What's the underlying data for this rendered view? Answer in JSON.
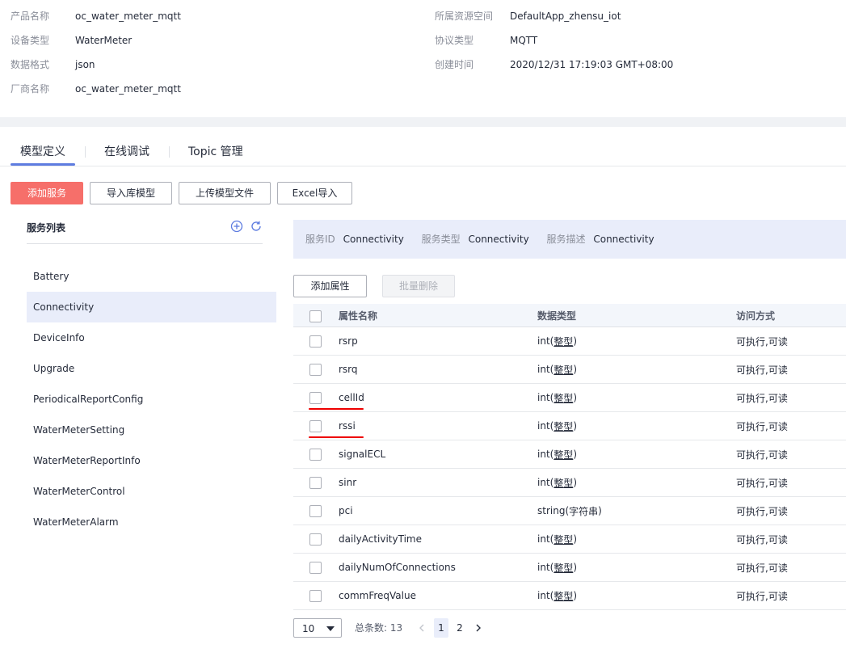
{
  "product_info": {
    "left": [
      {
        "label": "产品名称",
        "value": "oc_water_meter_mqtt"
      },
      {
        "label": "设备类型",
        "value": "WaterMeter"
      },
      {
        "label": "数据格式",
        "value": "json"
      },
      {
        "label": "厂商名称",
        "value": "oc_water_meter_mqtt"
      }
    ],
    "right": [
      {
        "label": "所属资源空间",
        "value": "DefaultApp_zhensu_iot"
      },
      {
        "label": "协议类型",
        "value": "MQTT"
      },
      {
        "label": "创建时间",
        "value": "2020/12/31 17:19:03 GMT+08:00"
      }
    ]
  },
  "tabs": [
    {
      "label": "模型定义",
      "active": true
    },
    {
      "label": "在线调试",
      "active": false
    },
    {
      "label": "Topic 管理",
      "active": false
    }
  ],
  "toolbar": {
    "add_service": "添加服务",
    "import_library_model": "导入库模型",
    "upload_model_file": "上传模型文件",
    "excel_import": "Excel导入"
  },
  "service_list": {
    "title": "服务列表",
    "selected": "Connectivity",
    "items": [
      "Battery",
      "Connectivity",
      "DeviceInfo",
      "Upgrade",
      "PeriodicalReportConfig",
      "WaterMeterSetting",
      "WaterMeterReportInfo",
      "WaterMeterControl",
      "WaterMeterAlarm"
    ]
  },
  "service_summary": {
    "id_label": "服务ID",
    "id_value": "Connectivity",
    "type_label": "服务类型",
    "type_value": "Connectivity",
    "desc_label": "服务描述",
    "desc_value": "Connectivity"
  },
  "property_actions": {
    "add_property": "添加属性",
    "batch_delete": "批量删除"
  },
  "property_table": {
    "columns": [
      "属性名称",
      "数据类型",
      "访问方式"
    ],
    "rows": [
      {
        "name": "rsrp",
        "type_prefix": "int(",
        "type_word": "整型",
        "type_suffix": ")",
        "access": "可执行,可读",
        "marked": false
      },
      {
        "name": "rsrq",
        "type_prefix": "int(",
        "type_word": "整型",
        "type_suffix": ")",
        "access": "可执行,可读",
        "marked": false
      },
      {
        "name": "cellId",
        "type_prefix": "int(",
        "type_word": "整型",
        "type_suffix": ")",
        "access": "可执行,可读",
        "marked": true
      },
      {
        "name": "rssi",
        "type_prefix": "int(",
        "type_word": "整型",
        "type_suffix": ")",
        "access": "可执行,可读",
        "marked": true
      },
      {
        "name": "signalECL",
        "type_prefix": "int(",
        "type_word": "整型",
        "type_suffix": ")",
        "access": "可执行,可读",
        "marked": false
      },
      {
        "name": "sinr",
        "type_prefix": "int(",
        "type_word": "整型",
        "type_suffix": ")",
        "access": "可执行,可读",
        "marked": false
      },
      {
        "name": "pci",
        "type_prefix": "string(",
        "type_word": "字符串",
        "type_suffix": ")",
        "access": "可执行,可读",
        "marked": false,
        "plain_type": true
      },
      {
        "name": "dailyActivityTime",
        "type_prefix": "int(",
        "type_word": "整型",
        "type_suffix": ")",
        "access": "可执行,可读",
        "marked": false
      },
      {
        "name": "dailyNumOfConnections",
        "type_prefix": "int(",
        "type_word": "整型",
        "type_suffix": ")",
        "access": "可执行,可读",
        "marked": false
      },
      {
        "name": "commFreqValue",
        "type_prefix": "int(",
        "type_word": "整型",
        "type_suffix": ")",
        "access": "可执行,可读",
        "marked": false
      }
    ]
  },
  "pagination": {
    "page_size": "10",
    "total_label": "总条数: 13",
    "pages": [
      "1",
      "2"
    ],
    "current_page": "1"
  },
  "colors": {
    "primary_button": "#f66f6a",
    "tab_underline": "#5e7ce0",
    "selected_bg": "#e9edfa",
    "annotation_red": "#e00000"
  }
}
